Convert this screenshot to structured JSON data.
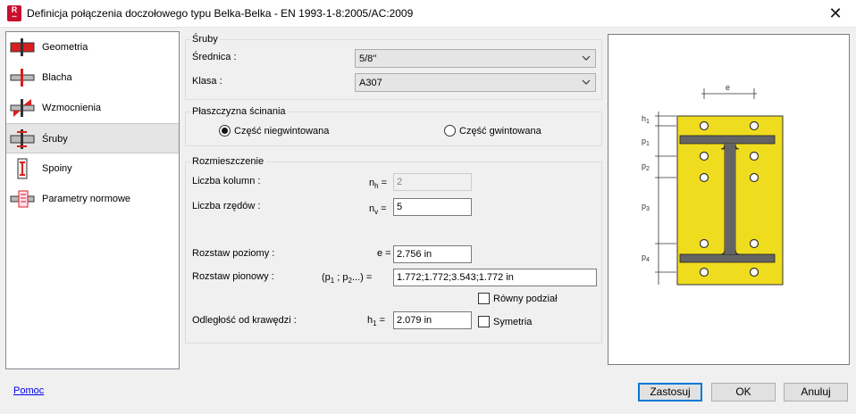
{
  "window": {
    "title": "Definicja połączenia doczołowego typu Belka-Belka - EN 1993-1-8:2005/AC:2009",
    "app_icon_letter": "R"
  },
  "nav": {
    "items": [
      {
        "label": "Geometria",
        "icon": "beam-geometry-icon"
      },
      {
        "label": "Blacha",
        "icon": "plate-icon"
      },
      {
        "label": "Wzmocnienia",
        "icon": "stiffener-icon"
      },
      {
        "label": "Śruby",
        "icon": "bolts-icon"
      },
      {
        "label": "Spoiny",
        "icon": "welds-icon"
      },
      {
        "label": "Parametry normowe",
        "icon": "code-parameters-icon"
      }
    ],
    "selected": "Śruby"
  },
  "bolts": {
    "group_title": "Śruby",
    "diameter_label": "Średnica :",
    "diameter_value": "5/8''",
    "class_label": "Klasa :",
    "class_value": "A307"
  },
  "shear_plane": {
    "group_title": "Płaszczyzna ścinania",
    "option_unthreaded": "Część niegwintowana",
    "option_threaded": "Część gwintowana",
    "selected": "unthreaded"
  },
  "layout": {
    "group_title": "Rozmieszczenie",
    "columns_label": "Liczba kolumn :",
    "columns_symbol": "n",
    "columns_sub": "h",
    "columns_value": "2",
    "rows_label": "Liczba rzędów :",
    "rows_symbol": "n",
    "rows_sub": "v",
    "rows_value": "5",
    "h_spacing_label": "Rozstaw poziomy :",
    "h_spacing_symbol": "e =",
    "h_spacing_value": "2.756 in",
    "v_spacing_label": "Rozstaw pionowy :",
    "v_spacing_symbol_open": "(p",
    "v_spacing_sub1": "1",
    "v_spacing_mid": " ; p",
    "v_spacing_sub2": "2",
    "v_spacing_end": "...) =",
    "v_spacing_value": "1.772;1.772;3.543;1.772 in",
    "equal_division_label": "Równy podział",
    "edge_distance_label": "Odległość od krawędzi :",
    "edge_symbol": "h",
    "edge_sub": "1",
    "edge_value": "2.079 in",
    "symmetry_label": "Symetria"
  },
  "preview": {
    "labels": {
      "e": "e",
      "h1": "h",
      "h1_sub": "1",
      "p1": "p",
      "p1_sub": "1",
      "p2": "p",
      "p2_sub": "2",
      "p3": "p",
      "p3_sub": "3",
      "p4": "p",
      "p4_sub": "4"
    },
    "plate_color": "#f0dc1e",
    "section_color": "#646464"
  },
  "footer": {
    "help_label": "Pomoc",
    "apply_label": "Zastosuj",
    "ok_label": "OK",
    "cancel_label": "Anuluj"
  }
}
